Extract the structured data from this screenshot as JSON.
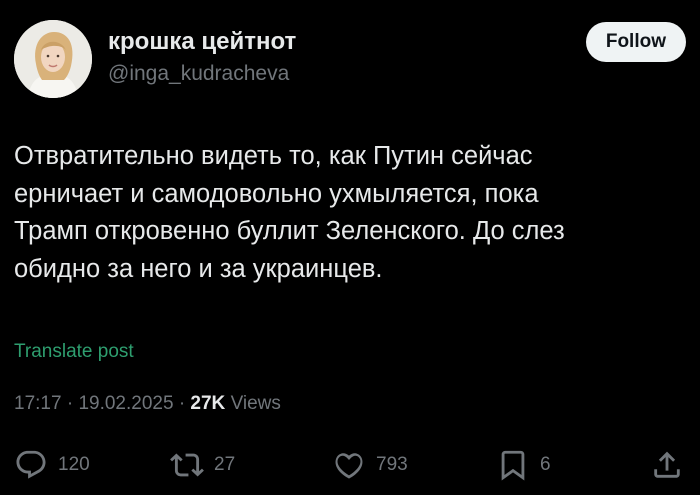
{
  "author": {
    "display_name": "крошка цейтнот",
    "handle": "@inga_kudracheva",
    "avatar_icon": "profile-photo"
  },
  "follow_label": "Follow",
  "tweet": {
    "lines": [
      "Отвратительно видеть то, как Путин сейчас",
      "ерничает и самодовольно ухмыляется, пока",
      "Трамп откровенно буллит Зеленского. До слез",
      "обидно за него и за украинцев."
    ]
  },
  "translate_label": "Translate post",
  "meta": {
    "time": "17:17",
    "date": "19.02.2025",
    "separator": "·",
    "views_count": "27K",
    "views_label": "Views"
  },
  "actions": {
    "replies": "120",
    "reposts": "27",
    "likes": "793",
    "bookmarks": "6"
  },
  "colors": {
    "background": "#000000",
    "text": "#e7e9ea",
    "muted": "#71767b",
    "translate": "#2e9e6f",
    "button_bg": "#eff3f4"
  }
}
